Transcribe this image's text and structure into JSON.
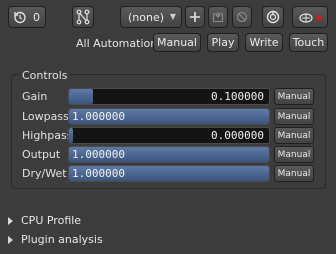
{
  "toolbar": {
    "history_count": "0",
    "preset_value": "(none)",
    "routing_icon": "routing-icon",
    "add_icon": "plus-icon",
    "save_icon": "save-icon",
    "delete_icon": "delete-icon",
    "bypass_icon": "bypass-icon",
    "pinout_icon": "pinout-icon"
  },
  "automation": {
    "label": "All Automation",
    "buttons": [
      "Manual",
      "Play",
      "Write",
      "Touch"
    ]
  },
  "controls": {
    "title": "Controls",
    "params": [
      {
        "label": "Gain",
        "value": "0.100000",
        "fill_fraction": 0.12,
        "align": "right",
        "mode": "Manual"
      },
      {
        "label": "Lowpass",
        "value": "1.000000",
        "fill_fraction": 1.0,
        "align": "left",
        "mode": "Manual"
      },
      {
        "label": "Highpass",
        "value": "0.000000",
        "fill_fraction": 0.02,
        "align": "right",
        "mode": "Manual"
      },
      {
        "label": "Output",
        "value": "1.000000",
        "fill_fraction": 1.0,
        "align": "left",
        "mode": "Manual"
      },
      {
        "label": "Dry/Wet",
        "value": "1.000000",
        "fill_fraction": 1.0,
        "align": "left",
        "mode": "Manual"
      }
    ]
  },
  "sections": [
    "CPU Profile",
    "Plugin analysis"
  ],
  "colors": {
    "background": "#3c3c3c",
    "slider_fill": "#4a6590",
    "record_dot": "#c02020"
  }
}
